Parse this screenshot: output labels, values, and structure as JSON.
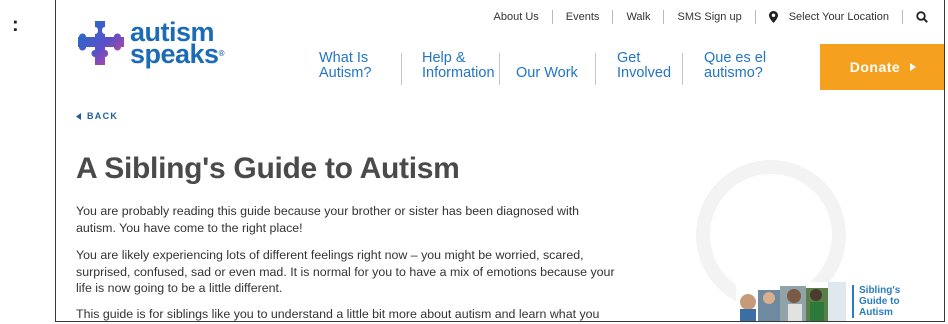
{
  "utility_nav": {
    "items": [
      "About Us",
      "Events",
      "Walk",
      "SMS Sign up"
    ],
    "location_label": "Select Your Location"
  },
  "logo": {
    "line1": "autism",
    "line2": "speaks",
    "trademark": "®"
  },
  "main_nav": {
    "items": [
      {
        "lines": [
          "What Is",
          "Autism?"
        ]
      },
      {
        "lines": [
          "Help &",
          "Information"
        ]
      },
      {
        "lines": [
          "",
          "Our Work"
        ]
      },
      {
        "lines": [
          "Get",
          "Involved"
        ]
      },
      {
        "lines": [
          "Que es el",
          "autismo?"
        ]
      }
    ]
  },
  "donate": {
    "label": "Donate"
  },
  "back": {
    "label": "BACK"
  },
  "article": {
    "title": "A Sibling's Guide to Autism",
    "paragraphs": [
      "You are probably reading this guide because your brother or sister has been diagnosed with autism. You have come to the right place!",
      "You are likely experiencing lots of different feelings right now – you might be worried, scared, surprised, confused, sad or even mad. It is normal for you to have a mix of  emotions because your life is now going to be a little different.",
      "This guide is for siblings like you to understand a little bit more about autism and learn what you"
    ]
  },
  "guide_thumbnail": {
    "title_lines": [
      "Sibling's",
      "Guide to",
      "Autism"
    ]
  },
  "colors": {
    "brand_blue": "#1b6cb5",
    "nav_blue": "#2275c4",
    "donate_orange": "#f5a11f"
  },
  "icons": {
    "location": "map-pin-icon",
    "search": "search-icon",
    "back": "caret-left-icon",
    "donate": "caret-right-icon"
  }
}
